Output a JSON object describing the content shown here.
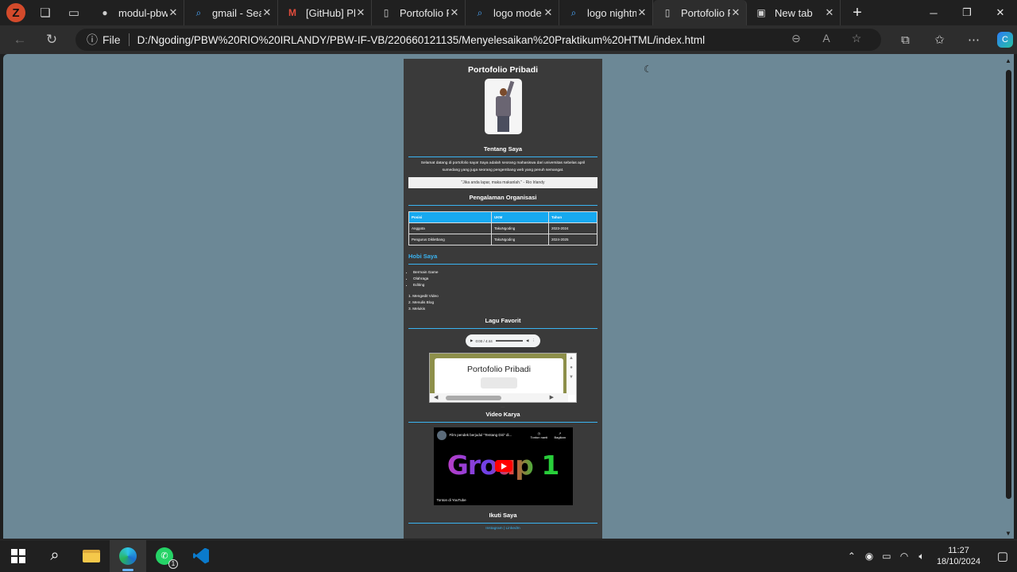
{
  "browser": {
    "profile_initial": "Z",
    "tabs": [
      {
        "title": "modul-pbw",
        "favicon": "github-icon"
      },
      {
        "title": "gmail - Search",
        "favicon": "search-icon"
      },
      {
        "title": "[GitHub] Ple",
        "favicon": "gmail-icon"
      },
      {
        "title": "Portofolio P",
        "favicon": "page-icon"
      },
      {
        "title": "logo mode n",
        "favicon": "search-icon"
      },
      {
        "title": "logo nightm",
        "favicon": "search-icon"
      },
      {
        "title": "Portofolio P",
        "favicon": "page-icon",
        "active": true
      },
      {
        "title": "New tab",
        "favicon": "newtab-icon"
      }
    ],
    "address": {
      "scheme_label": "File",
      "url": "D:/Ngoding/PBW%20RIO%20IRLANDY/PBW-IF-VB/220660121135/Menyelesaikan%20Praktikum%20HTML/index.html"
    }
  },
  "page": {
    "title": "Portofolio Pribadi",
    "about_heading": "Tentang Saya",
    "about_text": "Selamat datang di portofolio saya! Saya adalah seorang mahasiswa dari universitas sebelas april sumedang yang juga seorang pengembang web yang penuh semangat.",
    "quote": "\"Jika anda lapar, maka makanlah.\" - Rio Irlandy",
    "org_heading": "Pengalaman Organisasi",
    "table": {
      "headers": [
        "Posisi",
        "UKM",
        "Tahun"
      ],
      "rows": [
        [
          "Anggota",
          "TakuNgoding",
          "2023-2024"
        ],
        [
          "Pengurus Dikletbang",
          "TakuNgoding",
          "2024-2025"
        ]
      ]
    },
    "hobby_heading": "Hobi Saya",
    "hobbies_ul": [
      "Bermain Game",
      "Olahraga",
      "Editing"
    ],
    "hobbies_ol": [
      "Mengedit Video",
      "Menulis Blog",
      "Melukis"
    ],
    "music_heading": "Lagu Favorit",
    "audio_time": "0:00 / 4:44",
    "embed_title": "Portofolio Pribadi",
    "video_heading": "Video Karya",
    "video": {
      "title": "Film pendek berjudul \"Tentang Diri\" di...",
      "watch_later": "Tonton nanti",
      "share": "Bagikan",
      "overlay_text": "Group 1",
      "watch_on": "Tonton di YouTube"
    },
    "follow_heading": "Ikuti Saya",
    "follow_links": "Instagram | LinkedIn"
  },
  "taskbar": {
    "whatsapp_badge": "1",
    "time": "11:27",
    "date": "18/10/2024"
  }
}
